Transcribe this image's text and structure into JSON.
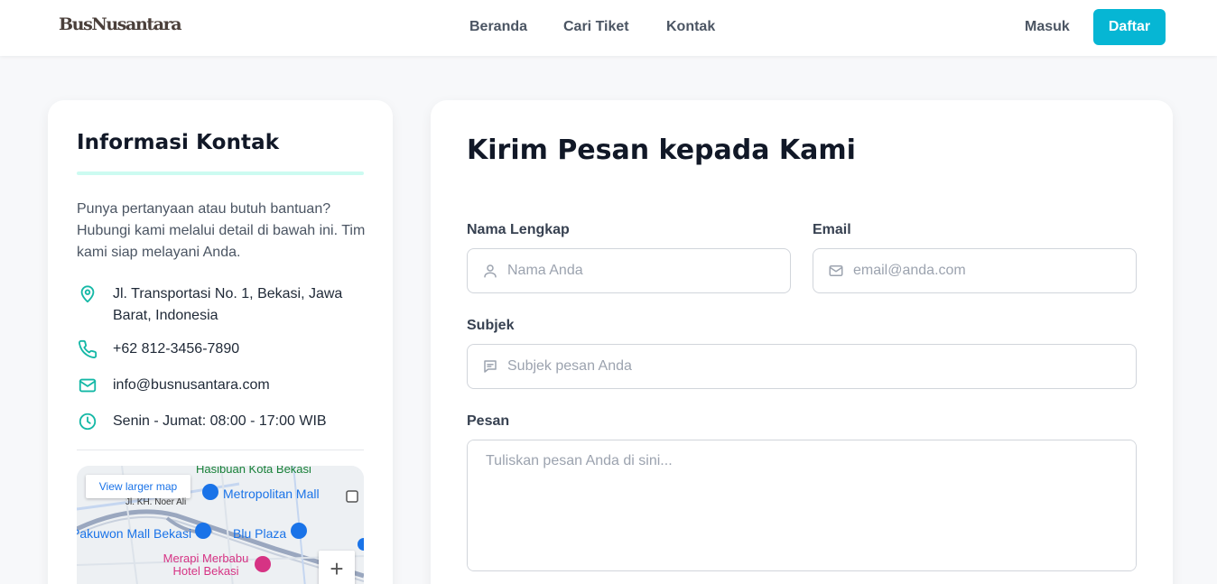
{
  "header": {
    "logo": "BusNusantara",
    "nav": [
      "Beranda",
      "Cari Tiket",
      "Kontak"
    ],
    "login": "Masuk",
    "register": "Daftar",
    "accent": "#06b6d4"
  },
  "contact_info": {
    "title": "Informasi Kontak",
    "description": "Punya pertanyaan atau butuh bantuan? Hubungi kami melalui detail di bawah ini. Tim kami siap melayani Anda.",
    "address": "Jl. Transportasi No. 1, Bekasi, Jawa Barat, Indonesia",
    "phone": "+62 812-3456-7890",
    "email": "info@busnusantara.com",
    "hours": "Senin - Jumat: 08:00 - 17:00 WIB",
    "icon_color": "#14b8a6",
    "map": {
      "link": "View larger map",
      "zoom_in": "+",
      "labels": [
        "Hasibuan Kota Bekasi",
        "Metropolitan Mall",
        "Jl. KH. Noer Ali",
        "Pakuwon Mall Bekasi",
        "Blu Plaza",
        "Merapi Merbabu Hotel Bekasi"
      ]
    }
  },
  "form": {
    "title": "Kirim Pesan kepada Kami",
    "name_label": "Nama Lengkap",
    "name_placeholder": "Nama Anda",
    "email_label": "Email",
    "email_placeholder": "email@anda.com",
    "subject_label": "Subjek",
    "subject_placeholder": "Subjek pesan Anda",
    "message_label": "Pesan",
    "message_placeholder": "Tuliskan pesan Anda di sini..."
  }
}
